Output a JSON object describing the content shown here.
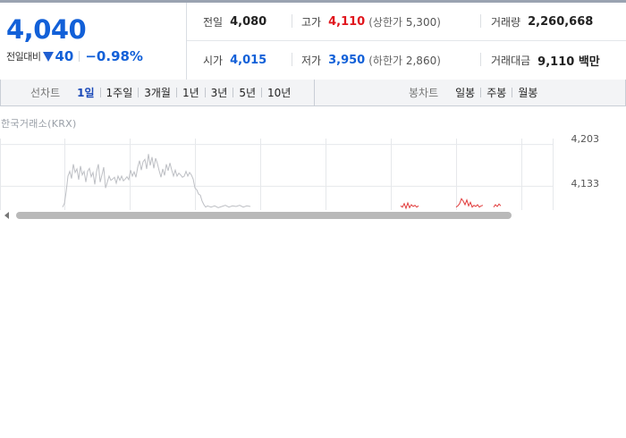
{
  "summary": {
    "price": "4,040",
    "change_label": "전일대비",
    "change_value": "40",
    "change_percent": "−0.98%",
    "prev_close_label": "전일",
    "prev_close": "4,080",
    "high_label": "고가",
    "high": "4,110",
    "upper_limit_label": "(상한가",
    "upper_limit": "5,300",
    "close_paren": ")",
    "volume_label": "거래량",
    "volume": "2,260,668",
    "open_label": "시가",
    "open": "4,015",
    "low_label": "저가",
    "low": "3,950",
    "lower_limit_label": "(하한가",
    "lower_limit": "2,860",
    "amount_label": "거래대금",
    "amount": "9,110 백만"
  },
  "line_tabs": {
    "title": "선차트",
    "items": [
      "1일",
      "1주일",
      "3개월",
      "1년",
      "3년",
      "5년",
      "10년"
    ],
    "active": "1일"
  },
  "candle_tabs": {
    "title": "봉차트",
    "items": [
      "일봉",
      "주봉",
      "월봉"
    ]
  },
  "chart": {
    "source": "한국거래소(KRX)",
    "y_ticks": [
      "4,203",
      "4,133"
    ]
  },
  "chart_data": {
    "type": "line",
    "title": "",
    "xlabel": "",
    "ylabel": "",
    "y_ticks": [
      4203,
      4133
    ],
    "ylim": [
      4093,
      4213
    ],
    "grid": true,
    "series": [
      {
        "color": "#bdbfc4",
        "x": [
          70,
          72,
          74,
          76,
          78,
          80,
          82,
          84,
          86,
          88,
          90,
          92,
          94,
          96,
          98,
          100,
          102,
          104,
          106,
          108,
          110,
          112,
          114,
          116,
          118,
          120,
          122,
          124,
          126,
          128,
          130,
          132,
          134,
          136,
          138,
          140,
          142,
          144,
          146,
          148,
          150,
          152,
          154,
          156,
          158,
          160,
          162,
          164,
          166,
          168,
          170,
          172,
          174,
          176,
          178,
          180,
          182,
          184,
          186,
          188,
          190,
          192,
          194,
          196,
          198,
          200,
          202,
          204,
          206,
          208,
          210,
          212,
          214,
          216,
          218,
          220,
          222,
          224,
          226,
          228,
          230,
          232
        ],
        "values": [
          4098,
          4104,
          4124,
          4150,
          4158,
          4146,
          4170,
          4156,
          4162,
          4144,
          4167,
          4152,
          4158,
          4140,
          4158,
          4163,
          4149,
          4156,
          4136,
          4158,
          4170,
          4140,
          4152,
          4165,
          4130,
          4140,
          4150,
          4143,
          4145,
          4148,
          4138,
          4150,
          4143,
          4150,
          4142,
          4145,
          4149,
          4144,
          4160,
          4150,
          4157,
          4148,
          4165,
          4176,
          4160,
          4174,
          4178,
          4162,
          4187,
          4168,
          4182,
          4163,
          4180,
          4171,
          4159,
          4148,
          4162,
          4151,
          4170,
          4159,
          4172,
          4160,
          4150,
          4160,
          4150,
          4155,
          4152,
          4148,
          4150,
          4158,
          4150,
          4156,
          4152,
          4145,
          4130,
          4127,
          4120,
          4118,
          4108,
          4102,
          4098,
          4100
        ]
      },
      {
        "color": "#bdbfc4",
        "x": [
          232,
          236,
          240,
          244,
          248,
          252,
          256,
          260,
          264,
          268,
          272,
          276,
          280
        ],
        "values": [
          4100,
          4098,
          4100,
          4097,
          4099,
          4101,
          4098,
          4100,
          4099,
          4101,
          4098,
          4100,
          4099
        ]
      },
      {
        "color": "#e13b3b",
        "x": [
          448,
          450,
          452,
          454,
          456,
          458,
          460,
          462,
          464,
          466,
          468
        ],
        "values": [
          4100,
          4098,
          4104,
          4096,
          4105,
          4097,
          4102,
          4099,
          4101,
          4098,
          4100
        ]
      },
      {
        "color": "#e13b3b",
        "x": [
          510,
          512,
          514,
          516,
          518,
          520,
          522,
          524,
          526,
          528,
          530,
          532,
          534,
          536,
          538,
          540
        ],
        "values": [
          4098,
          4100,
          4104,
          4112,
          4108,
          4102,
          4110,
          4100,
          4106,
          4098,
          4101,
          4099,
          4102,
          4098,
          4100,
          4101
        ]
      },
      {
        "color": "#e13b3b",
        "x": [
          552,
          554,
          556,
          558,
          560
        ],
        "values": [
          4098,
          4102,
          4099,
          4103,
          4100
        ]
      }
    ]
  }
}
